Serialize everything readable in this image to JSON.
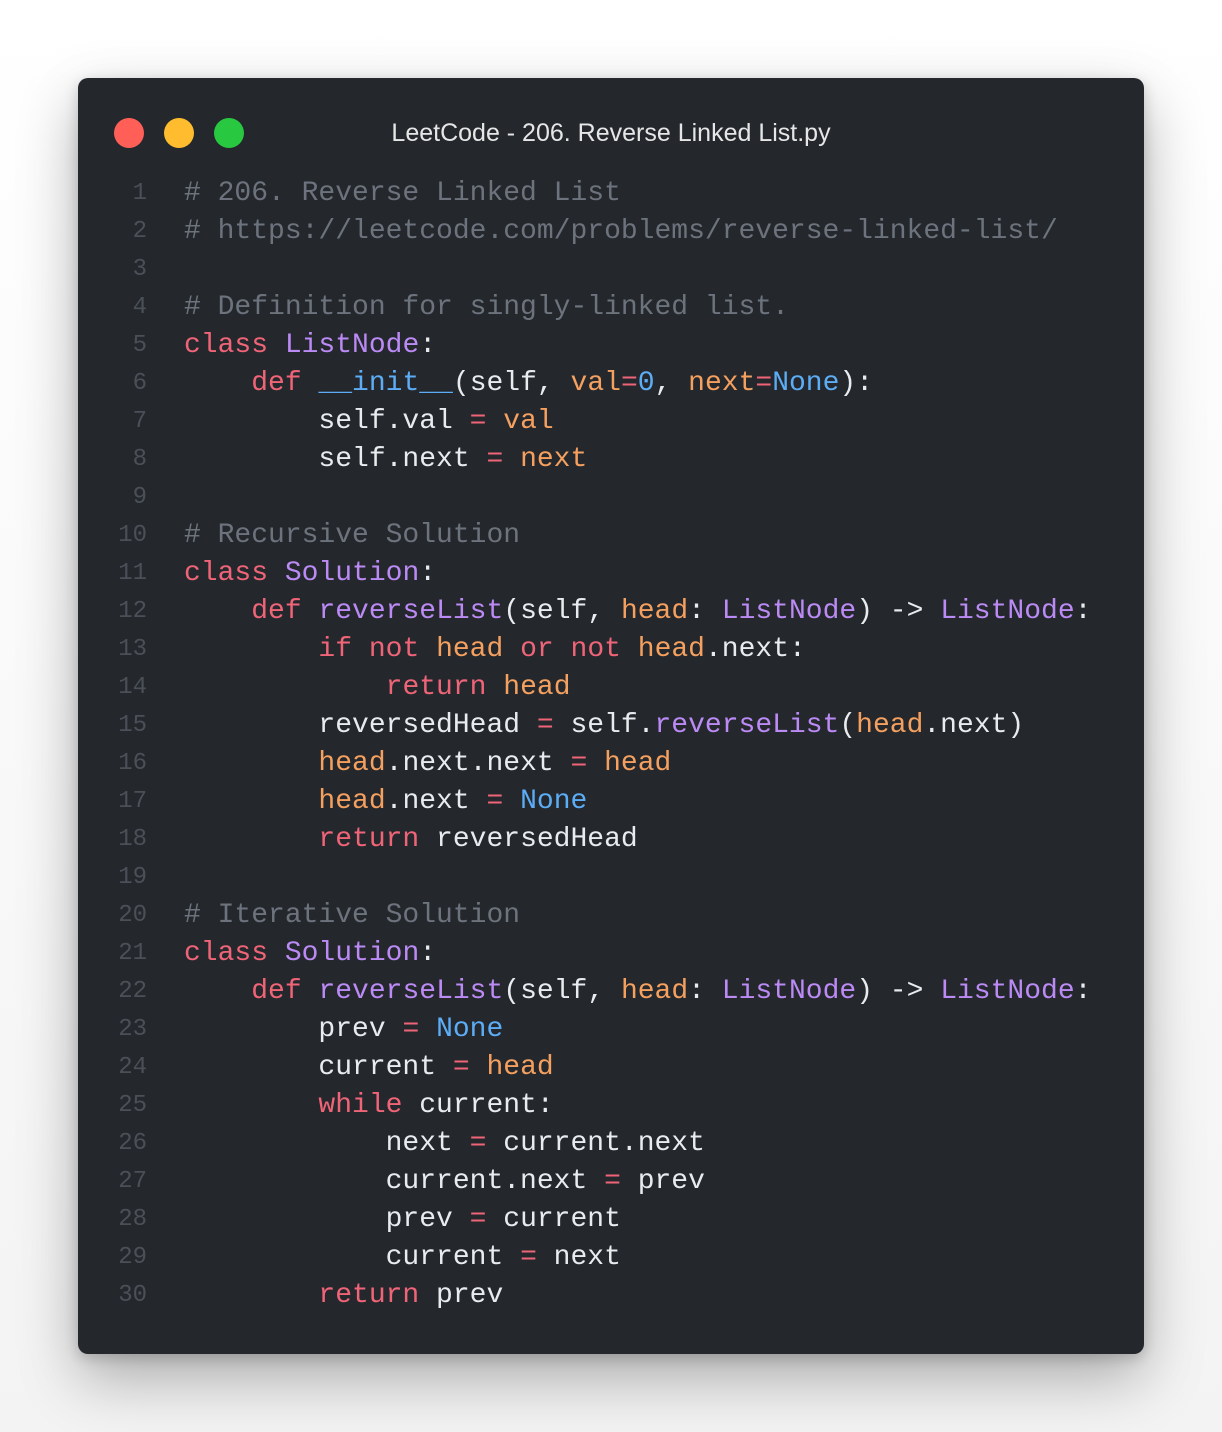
{
  "window": {
    "title": "LeetCode - 206. Reverse Linked List.py"
  },
  "colors": {
    "background": "#24282d",
    "comment": "#6d737d",
    "keyword": "#f06478",
    "class_name": "#bb8af5",
    "builtin": "#5cadf5",
    "parameter": "#f5a05f",
    "text": "#e9ecef",
    "line_number": "#4b5058",
    "traffic_red": "#ff5f57",
    "traffic_yellow": "#febc2e",
    "traffic_green": "#28c840"
  },
  "code": {
    "language": "python",
    "lines": [
      {
        "num": "1",
        "tokens": [
          [
            "comment",
            "# 206. Reverse Linked List"
          ]
        ]
      },
      {
        "num": "2",
        "tokens": [
          [
            "comment",
            "# https://leetcode.com/problems/reverse-linked-list/"
          ]
        ]
      },
      {
        "num": "3",
        "tokens": []
      },
      {
        "num": "4",
        "tokens": [
          [
            "comment",
            "# Definition for singly-linked list."
          ]
        ]
      },
      {
        "num": "5",
        "tokens": [
          [
            "keyword",
            "class"
          ],
          [
            "text",
            " "
          ],
          [
            "classname",
            "ListNode"
          ],
          [
            "punc",
            ":"
          ]
        ]
      },
      {
        "num": "6",
        "tokens": [
          [
            "text",
            "    "
          ],
          [
            "keyword",
            "def"
          ],
          [
            "text",
            " "
          ],
          [
            "builtin",
            "__init__"
          ],
          [
            "punc",
            "("
          ],
          [
            "text",
            "self"
          ],
          [
            "punc",
            ", "
          ],
          [
            "param",
            "val"
          ],
          [
            "op",
            "="
          ],
          [
            "const",
            "0"
          ],
          [
            "punc",
            ", "
          ],
          [
            "param",
            "next"
          ],
          [
            "op",
            "="
          ],
          [
            "const",
            "None"
          ],
          [
            "punc",
            "):"
          ]
        ]
      },
      {
        "num": "7",
        "tokens": [
          [
            "text",
            "        self.val "
          ],
          [
            "op",
            "="
          ],
          [
            "text",
            " "
          ],
          [
            "param",
            "val"
          ]
        ]
      },
      {
        "num": "8",
        "tokens": [
          [
            "text",
            "        self.next "
          ],
          [
            "op",
            "="
          ],
          [
            "text",
            " "
          ],
          [
            "param",
            "next"
          ]
        ]
      },
      {
        "num": "9",
        "tokens": []
      },
      {
        "num": "10",
        "tokens": [
          [
            "comment",
            "# Recursive Solution"
          ]
        ]
      },
      {
        "num": "11",
        "tokens": [
          [
            "keyword",
            "class"
          ],
          [
            "text",
            " "
          ],
          [
            "classname",
            "Solution"
          ],
          [
            "punc",
            ":"
          ]
        ]
      },
      {
        "num": "12",
        "tokens": [
          [
            "text",
            "    "
          ],
          [
            "keyword",
            "def"
          ],
          [
            "text",
            " "
          ],
          [
            "func",
            "reverseList"
          ],
          [
            "punc",
            "("
          ],
          [
            "text",
            "self"
          ],
          [
            "punc",
            ", "
          ],
          [
            "param",
            "head"
          ],
          [
            "punc",
            ": "
          ],
          [
            "classname",
            "ListNode"
          ],
          [
            "punc",
            ") -> "
          ],
          [
            "classname",
            "ListNode"
          ],
          [
            "punc",
            ":"
          ]
        ]
      },
      {
        "num": "13",
        "tokens": [
          [
            "text",
            "        "
          ],
          [
            "keyword",
            "if"
          ],
          [
            "text",
            " "
          ],
          [
            "keyword",
            "not"
          ],
          [
            "text",
            " "
          ],
          [
            "param",
            "head"
          ],
          [
            "text",
            " "
          ],
          [
            "keyword",
            "or"
          ],
          [
            "text",
            " "
          ],
          [
            "keyword",
            "not"
          ],
          [
            "text",
            " "
          ],
          [
            "param",
            "head"
          ],
          [
            "text",
            ".next:"
          ]
        ]
      },
      {
        "num": "14",
        "tokens": [
          [
            "text",
            "            "
          ],
          [
            "keyword",
            "return"
          ],
          [
            "text",
            " "
          ],
          [
            "param",
            "head"
          ]
        ]
      },
      {
        "num": "15",
        "tokens": [
          [
            "text",
            "        reversedHead "
          ],
          [
            "op",
            "="
          ],
          [
            "text",
            " self."
          ],
          [
            "func",
            "reverseList"
          ],
          [
            "punc",
            "("
          ],
          [
            "param",
            "head"
          ],
          [
            "text",
            ".next)"
          ]
        ]
      },
      {
        "num": "16",
        "tokens": [
          [
            "text",
            "        "
          ],
          [
            "param",
            "head"
          ],
          [
            "text",
            ".next.next "
          ],
          [
            "op",
            "="
          ],
          [
            "text",
            " "
          ],
          [
            "param",
            "head"
          ]
        ]
      },
      {
        "num": "17",
        "tokens": [
          [
            "text",
            "        "
          ],
          [
            "param",
            "head"
          ],
          [
            "text",
            ".next "
          ],
          [
            "op",
            "="
          ],
          [
            "text",
            " "
          ],
          [
            "const",
            "None"
          ]
        ]
      },
      {
        "num": "18",
        "tokens": [
          [
            "text",
            "        "
          ],
          [
            "keyword",
            "return"
          ],
          [
            "text",
            " reversedHead"
          ]
        ]
      },
      {
        "num": "19",
        "tokens": []
      },
      {
        "num": "20",
        "tokens": [
          [
            "comment",
            "# Iterative Solution"
          ]
        ]
      },
      {
        "num": "21",
        "tokens": [
          [
            "keyword",
            "class"
          ],
          [
            "text",
            " "
          ],
          [
            "classname",
            "Solution"
          ],
          [
            "punc",
            ":"
          ]
        ]
      },
      {
        "num": "22",
        "tokens": [
          [
            "text",
            "    "
          ],
          [
            "keyword",
            "def"
          ],
          [
            "text",
            " "
          ],
          [
            "func",
            "reverseList"
          ],
          [
            "punc",
            "("
          ],
          [
            "text",
            "self"
          ],
          [
            "punc",
            ", "
          ],
          [
            "param",
            "head"
          ],
          [
            "punc",
            ": "
          ],
          [
            "classname",
            "ListNode"
          ],
          [
            "punc",
            ") -> "
          ],
          [
            "classname",
            "ListNode"
          ],
          [
            "punc",
            ":"
          ]
        ]
      },
      {
        "num": "23",
        "tokens": [
          [
            "text",
            "        prev "
          ],
          [
            "op",
            "="
          ],
          [
            "text",
            " "
          ],
          [
            "const",
            "None"
          ]
        ]
      },
      {
        "num": "24",
        "tokens": [
          [
            "text",
            "        current "
          ],
          [
            "op",
            "="
          ],
          [
            "text",
            " "
          ],
          [
            "param",
            "head"
          ]
        ]
      },
      {
        "num": "25",
        "tokens": [
          [
            "text",
            "        "
          ],
          [
            "keyword",
            "while"
          ],
          [
            "text",
            " current:"
          ]
        ]
      },
      {
        "num": "26",
        "tokens": [
          [
            "text",
            "            next "
          ],
          [
            "op",
            "="
          ],
          [
            "text",
            " current.next"
          ]
        ]
      },
      {
        "num": "27",
        "tokens": [
          [
            "text",
            "            current.next "
          ],
          [
            "op",
            "="
          ],
          [
            "text",
            " prev"
          ]
        ]
      },
      {
        "num": "28",
        "tokens": [
          [
            "text",
            "            prev "
          ],
          [
            "op",
            "="
          ],
          [
            "text",
            " current"
          ]
        ]
      },
      {
        "num": "29",
        "tokens": [
          [
            "text",
            "            current "
          ],
          [
            "op",
            "="
          ],
          [
            "text",
            " next"
          ]
        ]
      },
      {
        "num": "30",
        "tokens": [
          [
            "text",
            "        "
          ],
          [
            "keyword",
            "return"
          ],
          [
            "text",
            " prev"
          ]
        ]
      }
    ]
  }
}
